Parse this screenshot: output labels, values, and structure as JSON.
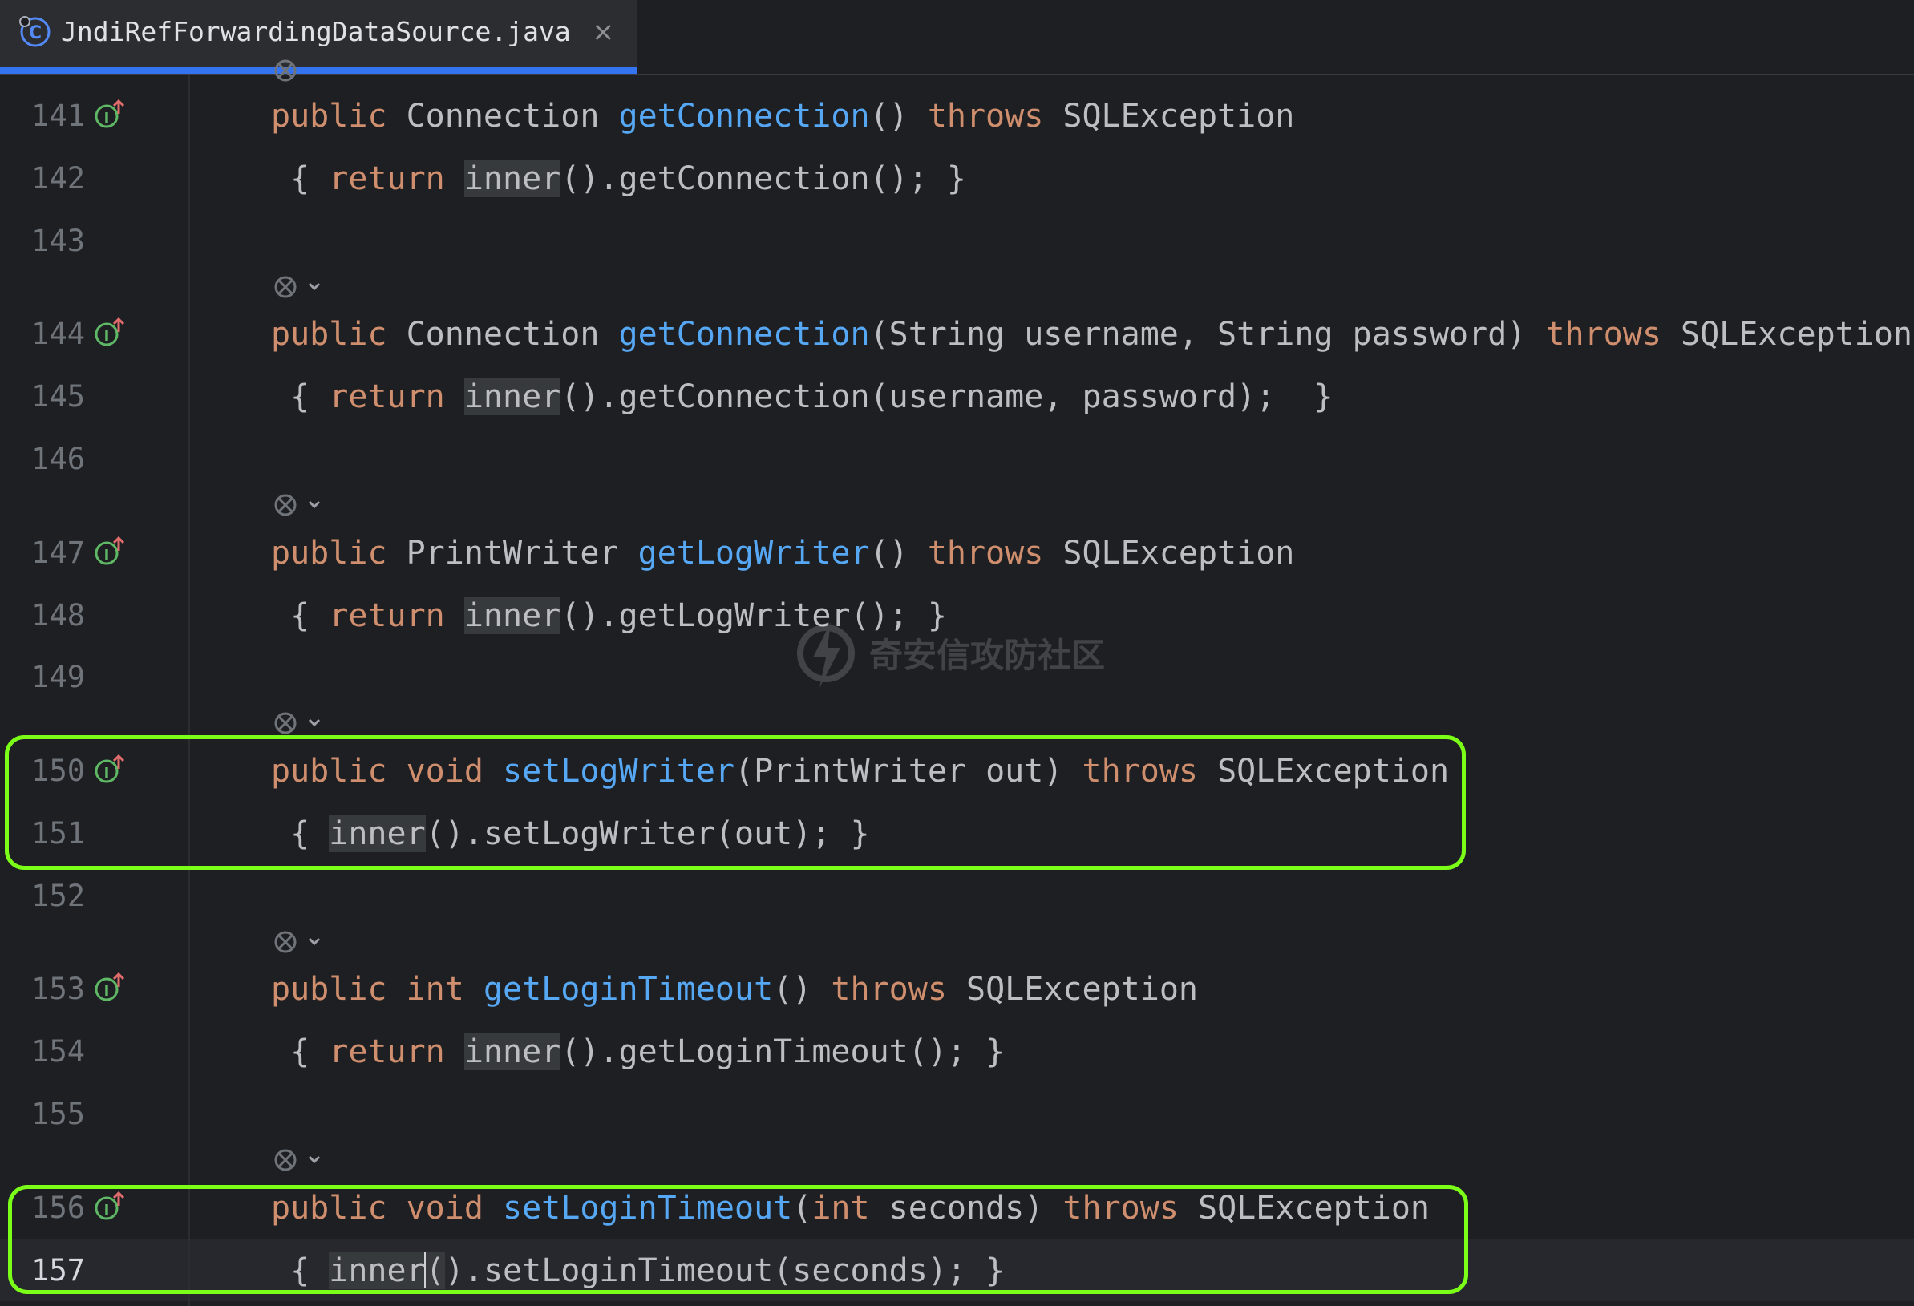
{
  "tab": {
    "title": "JndiRefForwardingDataSource.java",
    "close_glyph": "×",
    "icon": "java-class-icon"
  },
  "editor": {
    "colors": {
      "keyword": "#cf8e6d",
      "method": "#56a8f5",
      "text": "#bcbec4",
      "line_number": "#6f737a",
      "highlight_box": "#7cff18",
      "tab_underline": "#3574f0"
    },
    "lines": [
      {
        "num": "141",
        "impl": true,
        "tokens": [
          [
            "kw",
            "public"
          ],
          [
            "",
            "Connection"
          ],
          [
            "fn",
            "getConnection"
          ],
          [
            "",
            "() "
          ],
          [
            "kw",
            "throws"
          ],
          [
            "",
            " SQLException"
          ]
        ]
      },
      {
        "num": "142",
        "tokens": [
          [
            "",
            "{ "
          ],
          [
            "kw",
            "return"
          ],
          [
            "hl",
            "inner"
          ],
          [
            "",
            "().getConnection(); }"
          ]
        ]
      },
      {
        "num": "143"
      },
      {
        "num": "144",
        "impl": true
      },
      {
        "num": "145"
      },
      {
        "num": "146"
      },
      {
        "num": "147",
        "impl": true
      },
      {
        "num": "148"
      },
      {
        "num": "149"
      },
      {
        "num": "150",
        "impl": true
      },
      {
        "num": "151"
      },
      {
        "num": "152"
      },
      {
        "num": "153",
        "impl": true
      },
      {
        "num": "154"
      },
      {
        "num": "155"
      },
      {
        "num": "156",
        "impl": true
      },
      {
        "num": "157",
        "current": true
      }
    ],
    "code": {
      "l141": {
        "a": "public",
        "b": " Connection ",
        "c": "getConnection",
        "d": "() ",
        "e": "throws",
        "f": " SQLException"
      },
      "l142": {
        "a": " { ",
        "b": "return",
        "c": " ",
        "d": "inner",
        "e": "().getConnection(); }"
      },
      "l144": {
        "a": "public",
        "b": " Connection ",
        "c": "getConnection",
        "d": "(String username, String password) ",
        "e": "throws",
        "f": " SQLException"
      },
      "l145": {
        "a": " { ",
        "b": "return",
        "c": " ",
        "d": "inner",
        "e": "().getConnection(username, password);  }"
      },
      "l147": {
        "a": "public",
        "b": " PrintWriter ",
        "c": "getLogWriter",
        "d": "() ",
        "e": "throws",
        "f": " SQLException"
      },
      "l148": {
        "a": " { ",
        "b": "return",
        "c": " ",
        "d": "inner",
        "e": "().getLogWriter(); }"
      },
      "l150": {
        "a": "public",
        "b": " ",
        "c": "void",
        "d": " ",
        "e": "setLogWriter",
        "f": "(PrintWriter out) ",
        "g": "throws",
        "h": " SQLException"
      },
      "l151": {
        "a": " { ",
        "b": "inner",
        "c": "().setLogWriter(out); }"
      },
      "l153": {
        "a": "public",
        "b": " ",
        "c": "int",
        "d": " ",
        "e": "getLoginTimeout",
        "f": "() ",
        "g": "throws",
        "h": " SQLException"
      },
      "l154": {
        "a": " { ",
        "b": "return",
        "c": " ",
        "d": "inner",
        "e": "().getLoginTimeout(); }"
      },
      "l156": {
        "a": "public",
        "b": " ",
        "c": "void",
        "d": " ",
        "e": "setLoginTimeout",
        "f": "(",
        "g": "int",
        "h": " seconds) ",
        "i": "throws",
        "j": " SQLException"
      },
      "l157": {
        "a": " { ",
        "b": "inner",
        "c": "(",
        "d": ")",
        "e": ".setLoginTimeout(seconds); }"
      }
    }
  },
  "watermark": {
    "text": "奇安信攻防社区",
    "icon": "lightning-logo-icon"
  }
}
